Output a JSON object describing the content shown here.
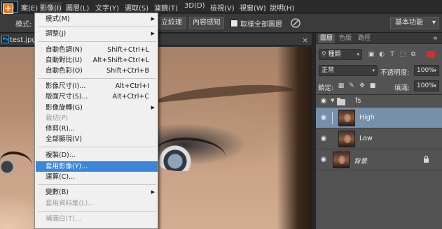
{
  "menubar": {
    "items": [
      {
        "label": "案(E)"
      },
      {
        "label": "影像(I)",
        "active": true
      },
      {
        "label": "圖層(L)"
      },
      {
        "label": "文字(Y)"
      },
      {
        "label": "選取(S)"
      },
      {
        "label": "濾鏡(T)"
      },
      {
        "label": "3D(D)"
      },
      {
        "label": "檢視(V)"
      },
      {
        "label": "視窗(W)"
      },
      {
        "label": "說明(H)"
      }
    ]
  },
  "optionsbar": {
    "mode_label": "模式:",
    "btn_texture": "立紋理",
    "btn_content_aware": "內容感知",
    "sample_all_label": "取樣全部圖層",
    "workspace": "基本功能"
  },
  "document": {
    "tab_title": "test.jpg @",
    "close_glyph": "×",
    "ps_glyph": "Ps"
  },
  "image_menu": {
    "items": [
      {
        "label": "模式(M)",
        "shortcut": "",
        "submenu": true,
        "disabled": false
      },
      {
        "label": "調整(J)",
        "shortcut": "",
        "submenu": true,
        "disabled": false
      },
      {
        "label": "自動色調(N)",
        "shortcut": "Shift+Ctrl+L",
        "submenu": false,
        "disabled": false
      },
      {
        "label": "自動對比(U)",
        "shortcut": "Alt+Shift+Ctrl+L",
        "submenu": false,
        "disabled": false
      },
      {
        "label": "自動色彩(O)",
        "shortcut": "Shift+Ctrl+B",
        "submenu": false,
        "disabled": false
      },
      {
        "label": "影像尺寸(I)...",
        "shortcut": "Alt+Ctrl+I",
        "submenu": false,
        "disabled": false
      },
      {
        "label": "版面尺寸(S)...",
        "shortcut": "Alt+Ctrl+C",
        "submenu": false,
        "disabled": false
      },
      {
        "label": "影像旋轉(G)",
        "shortcut": "",
        "submenu": true,
        "disabled": false
      },
      {
        "label": "裁切(P)",
        "shortcut": "",
        "submenu": false,
        "disabled": true
      },
      {
        "label": "修剪(R)...",
        "shortcut": "",
        "submenu": false,
        "disabled": false
      },
      {
        "label": "全部顯現(V)",
        "shortcut": "",
        "submenu": false,
        "disabled": false
      },
      {
        "label": "複製(D)...",
        "shortcut": "",
        "submenu": false,
        "disabled": false
      },
      {
        "label": "套用影像(Y)...",
        "shortcut": "",
        "submenu": false,
        "disabled": false,
        "highlight": true
      },
      {
        "label": "運算(C)...",
        "shortcut": "",
        "submenu": false,
        "disabled": false
      },
      {
        "label": "變數(B)",
        "shortcut": "",
        "submenu": true,
        "disabled": false
      },
      {
        "label": "套用資料集(L)...",
        "shortcut": "",
        "submenu": false,
        "disabled": true
      },
      {
        "label": "補漏白(T)...",
        "shortcut": "",
        "submenu": false,
        "disabled": true
      }
    ],
    "arrow_glyph": "▶"
  },
  "layers_panel": {
    "tabs": [
      "圖層",
      "色版",
      "路徑"
    ],
    "menu_glyph": "≡",
    "kind_filter": "種類",
    "blend_mode": "正常",
    "opacity_label": "不透明度:",
    "opacity_value": "100%",
    "lock_label": "鎖定:",
    "fill_label": "填滿:",
    "fill_value": "100%",
    "dropdown_glyph": "▾",
    "eye_glyph": "◉",
    "lock_glyph": "🔒",
    "group_arrow": "▼",
    "layers": [
      {
        "name": "fs",
        "type": "group",
        "selected": false
      },
      {
        "name": "High",
        "type": "layer",
        "selected": true,
        "gray": false
      },
      {
        "name": "Low",
        "type": "layer",
        "selected": false,
        "gray": false
      },
      {
        "name": "背景",
        "type": "background",
        "selected": false,
        "gray": false,
        "locked": true
      }
    ]
  }
}
